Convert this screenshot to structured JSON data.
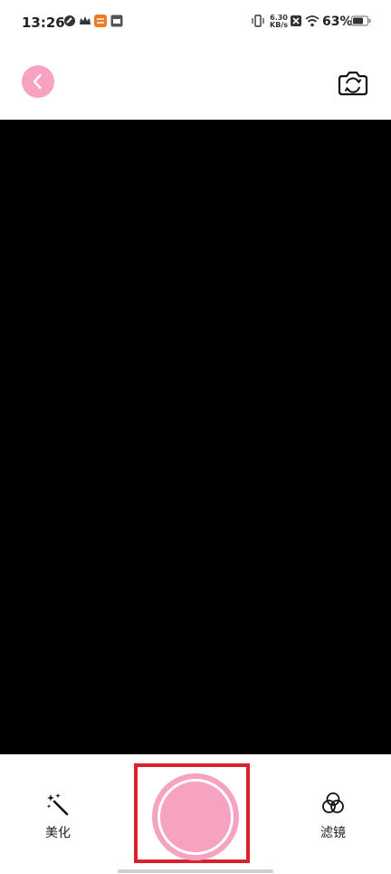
{
  "status_bar": {
    "time": "13:26",
    "net_speed_value": "6.30",
    "net_speed_unit": "KB/s",
    "battery_percent": "63%"
  },
  "header": {
    "back_icon": "chevron-left-icon",
    "switch_camera_icon": "camera-switch-icon"
  },
  "bottom_bar": {
    "beautify_label": "美化",
    "filter_label": "滤镜"
  },
  "colors": {
    "accent_pink": "#f6a2c0",
    "highlight_red": "#d9232b",
    "preview_bg": "#000000"
  }
}
